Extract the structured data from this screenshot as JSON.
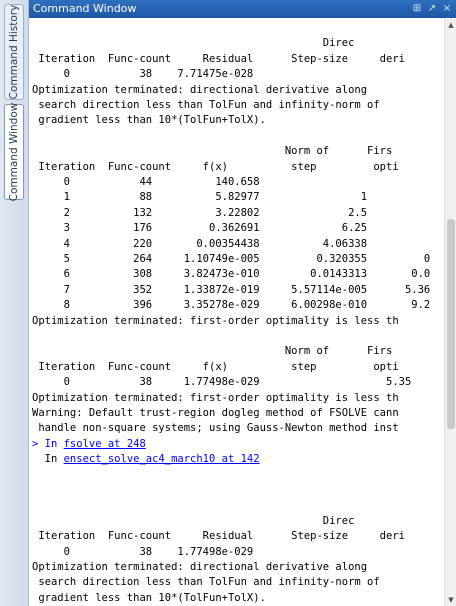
{
  "side_tabs": [
    "Command History",
    "Command Window"
  ],
  "window": {
    "title": "Command Window",
    "undock_icon": "undock-icon",
    "close_icon": "close-icon"
  },
  "console_lines": [
    "",
    "                                              Direc",
    " Iteration  Func-count     Residual      Step-size     deri",
    "     0           38    7.71475e-028",
    "Optimization terminated: directional derivative along",
    " search direction less than TolFun and infinity-norm of",
    " gradient less than 10*(TolFun+TolX).",
    "",
    "                                        Norm of      Firs",
    " Iteration  Func-count     f(x)          step         opti",
    "     0           44          140.658",
    "     1           88          5.82977                1",
    "     2          132          3.22802              2.5",
    "     3          176         0.362691             6.25",
    "     4          220       0.00354438          4.06338",
    "     5          264     1.10749e-005         0.320355         0",
    "     6          308     3.82473e-010        0.0143313       0.0",
    "     7          352     1.33872e-019     5.57114e-005      5.36",
    "     8          396     3.35278e-029     6.00298e-010       9.2",
    "Optimization terminated: first-order optimality is less th",
    "",
    "                                        Norm of      Firs",
    " Iteration  Func-count     f(x)          step         opti",
    "     0           38     1.77498e-029                    5.35",
    "Optimization terminated: first-order optimality is less th",
    "Warning: Default trust-region dogleg method of FSOLVE cann",
    " handle non-square systems; using Gauss-Newton method inst",
    "",
    "",
    "",
    "                                              Direc",
    " Iteration  Func-count     Residual      Step-size     deri",
    "     0           38    1.77498e-029",
    "Optimization terminated: directional derivative along",
    " search direction less than TolFun and infinity-norm of",
    " gradient less than 10*(TolFun+TolX)."
  ],
  "error_trace": [
    {
      "prefix": "> In ",
      "link": "fsolve at 248"
    },
    {
      "prefix": "  In ",
      "link": "ensect_solve_ac4_march10 at 142"
    }
  ],
  "prompt": "|"
}
